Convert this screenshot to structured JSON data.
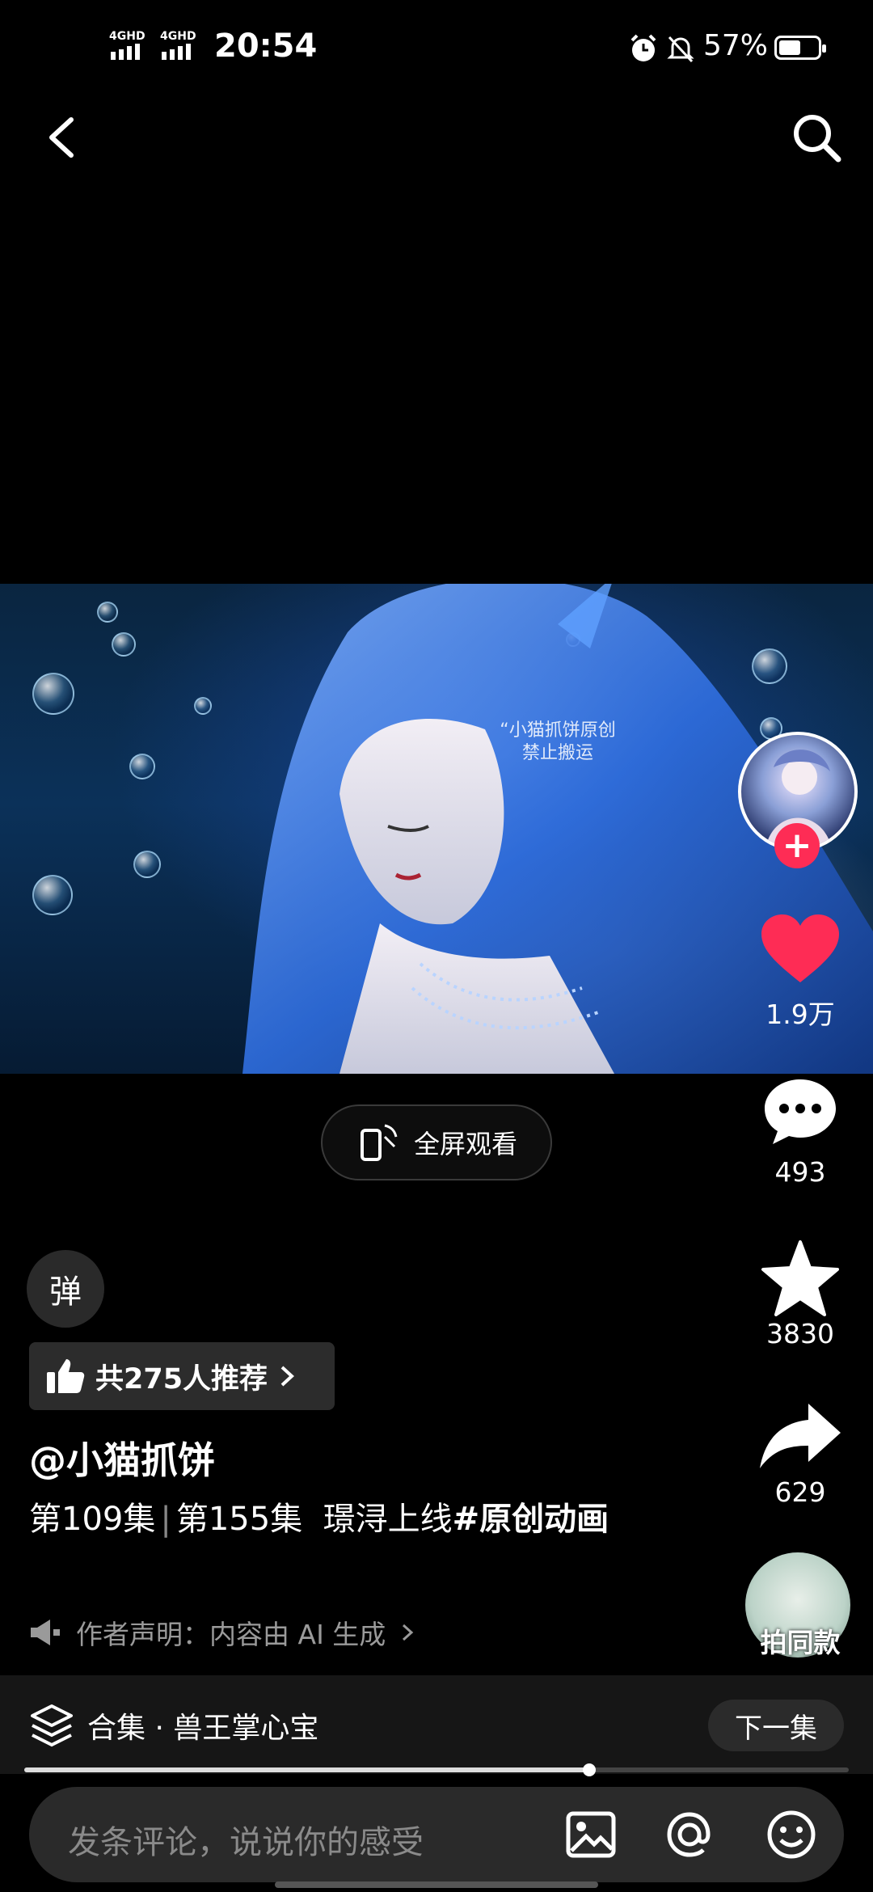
{
  "status_bar": {
    "network_1": "4GHD",
    "network_2": "4GHD",
    "time": "20:54",
    "battery_percent": "57%",
    "battery_level": 0.57
  },
  "video": {
    "watermark_line1": "“小猫抓饼原创",
    "watermark_line2": "禁止搬运"
  },
  "rail": {
    "like_count": "1.9万",
    "comment_count": "493",
    "favorite_count": "3830",
    "share_count": "629",
    "same_style_label": "拍同款"
  },
  "fullscreen_label": "全屏观看",
  "danmaku_label": "弹",
  "recommend_label": "共275人推荐",
  "author": "@小猫抓饼",
  "description": {
    "ep1": "第109集",
    "sep": "|",
    "ep2": "第155集",
    "text": "璟浔上线",
    "tag": "#原创动画"
  },
  "declaration": "作者声明：内容由 AI 生成",
  "collection": {
    "label": "合集 · 兽王掌心宝",
    "next_label": "下一集",
    "progress": 0.685
  },
  "comment": {
    "placeholder": "发条评论，说说你的感受"
  },
  "colors": {
    "like": "#fe2c55",
    "follow": "#fe2c55",
    "background": "#000000"
  }
}
